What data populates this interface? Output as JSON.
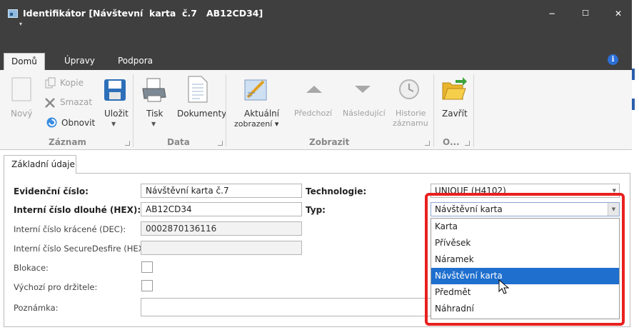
{
  "window": {
    "title": "Identifikátor [Návštevní  karta  č.7   AB12CD34]",
    "minimize": "−",
    "maximize": "☐",
    "close": "✕",
    "quick_access": "▾"
  },
  "tabs": [
    "Domů",
    "Úpravy",
    "Podpora"
  ],
  "ribbon": {
    "zaznam": {
      "label": "Záznam",
      "novy": "Nový",
      "kopie": "Kopie",
      "smazat": "Smazat",
      "obnovit": "Obnovit",
      "ulozit": "Uložit"
    },
    "data": {
      "label": "Data",
      "tisk": "Tisk",
      "dokumenty": "Dokumenty"
    },
    "zobrazit": {
      "label": "Zobrazit",
      "aktualni_line1": "Aktuální",
      "aktualni_line2": "zobrazení ▾",
      "predchozi": "Předchozí",
      "nasledujici": "Následující",
      "historie_line1": "Historie",
      "historie_line2": "záznamu"
    },
    "other": {
      "label": "O...",
      "zavrit": "Zavřít"
    }
  },
  "page_tab": "Základní údaje",
  "form": {
    "evidencni_label": "Evidenční číslo:",
    "evidencni_value": "Návštěvní karta č.7",
    "interni_hex_label": "Interní číslo dlouhé (HEX):",
    "interni_hex_value": "AB12CD34",
    "interni_dec_label": "Interní číslo krácené (DEC):",
    "interni_dec_value": "0002870136116",
    "securedesfire_label": "Interní číslo SecureDesfire (HEX):",
    "securedesfire_value": "",
    "blokace_label": "Blokace:",
    "vychozi_label": "Výchozí pro držitele:",
    "poznamka_label": "Poznámka:",
    "technologie_label": "Technologie:",
    "technologie_value": "UNIQUE (H4102)",
    "typ_label": "Typ:",
    "typ_value": "Návštěvní karta"
  },
  "dropdown": {
    "options": [
      "Karta",
      "Přívěsek",
      "Náramek",
      "Návštěvní karta",
      "Předmět",
      "Náhradní"
    ],
    "selected": "Návštěvní karta"
  },
  "colors": {
    "titlebar": "#3f3f3f",
    "selection": "#1e6fce",
    "highlight": "#e8201f"
  }
}
